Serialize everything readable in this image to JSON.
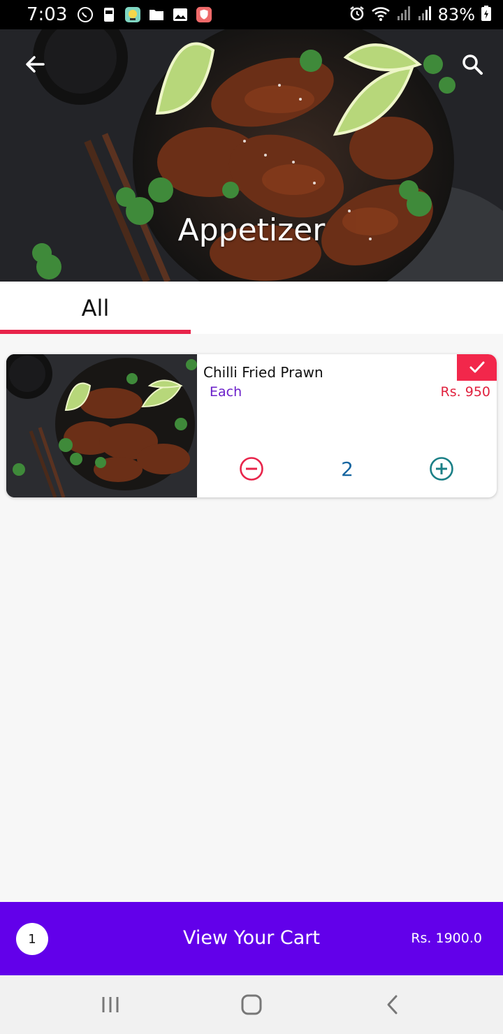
{
  "status_bar": {
    "time": "7:03",
    "battery": "83%",
    "icons_left": [
      "whatsapp-icon",
      "sim-icon",
      "app-icon",
      "folder-icon",
      "gallery-icon",
      "shield-app-icon"
    ],
    "icons_right": [
      "alarm-icon",
      "wifi-icon",
      "signal-icon",
      "signal-icon",
      "battery-icon"
    ]
  },
  "header": {
    "title": "Appetizer"
  },
  "tabs": [
    {
      "label": "All"
    }
  ],
  "items": [
    {
      "name": "Chilli Fried Prawn",
      "unit": "Each",
      "price": "Rs.  950",
      "quantity": "2",
      "selected": true
    }
  ],
  "cart": {
    "count": "1",
    "label": "View Your Cart",
    "total": "Rs. 1900.0"
  },
  "colors": {
    "accent_red": "#e8244a",
    "cart_purple": "#6200ea",
    "unit_purple": "#6a1fc9",
    "qty_blue": "#1565a0",
    "plus_teal": "#1a7f86"
  }
}
